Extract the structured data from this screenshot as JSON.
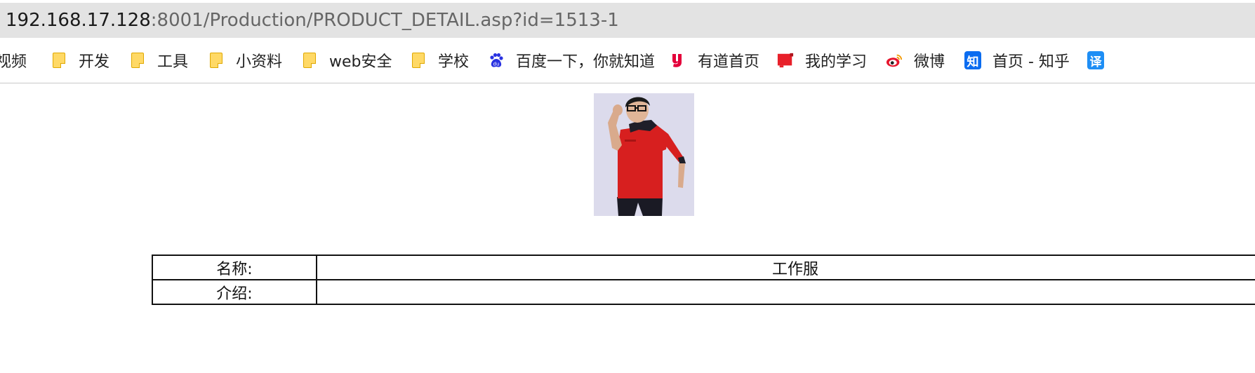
{
  "browser": {
    "url_host": "192.168.17.128",
    "url_rest": ":8001/Production/PRODUCT_DETAIL.asp?id=1513-1"
  },
  "bookmarks": [
    {
      "label": "视频",
      "icon": "none"
    },
    {
      "label": "开发",
      "icon": "folder-icon"
    },
    {
      "label": "工具",
      "icon": "folder-icon"
    },
    {
      "label": "小资料",
      "icon": "folder-icon"
    },
    {
      "label": "web安全",
      "icon": "folder-icon"
    },
    {
      "label": "学校",
      "icon": "folder-icon"
    },
    {
      "label": "百度一下，你就知道",
      "icon": "baidu-paw-icon"
    },
    {
      "label": "有道首页",
      "icon": "youdao-icon"
    },
    {
      "label": "我的学习",
      "icon": "red-note-icon"
    },
    {
      "label": "微博",
      "icon": "weibo-icon"
    },
    {
      "label": "首页 - 知乎",
      "icon": "zhihu-icon"
    },
    {
      "label": "",
      "icon": "translate-icon"
    }
  ],
  "icon_glyphs": {
    "zhihu": "知",
    "translate": "译"
  },
  "colors": {
    "urlbar_bg": "#e3e3e3",
    "folder": "#ffd966",
    "baidu": "#2932e1",
    "youdao": "#e4003a",
    "red_note": "#e8202a",
    "weibo": "#e6162d",
    "zhihu": "#0a6cf0",
    "shirt": "#d71f1f"
  },
  "product": {
    "image_alt": "red work uniform model photo",
    "table": {
      "rows": [
        {
          "label": "名称:",
          "value": "工作服"
        },
        {
          "label": "介绍:",
          "value": ""
        }
      ]
    }
  }
}
